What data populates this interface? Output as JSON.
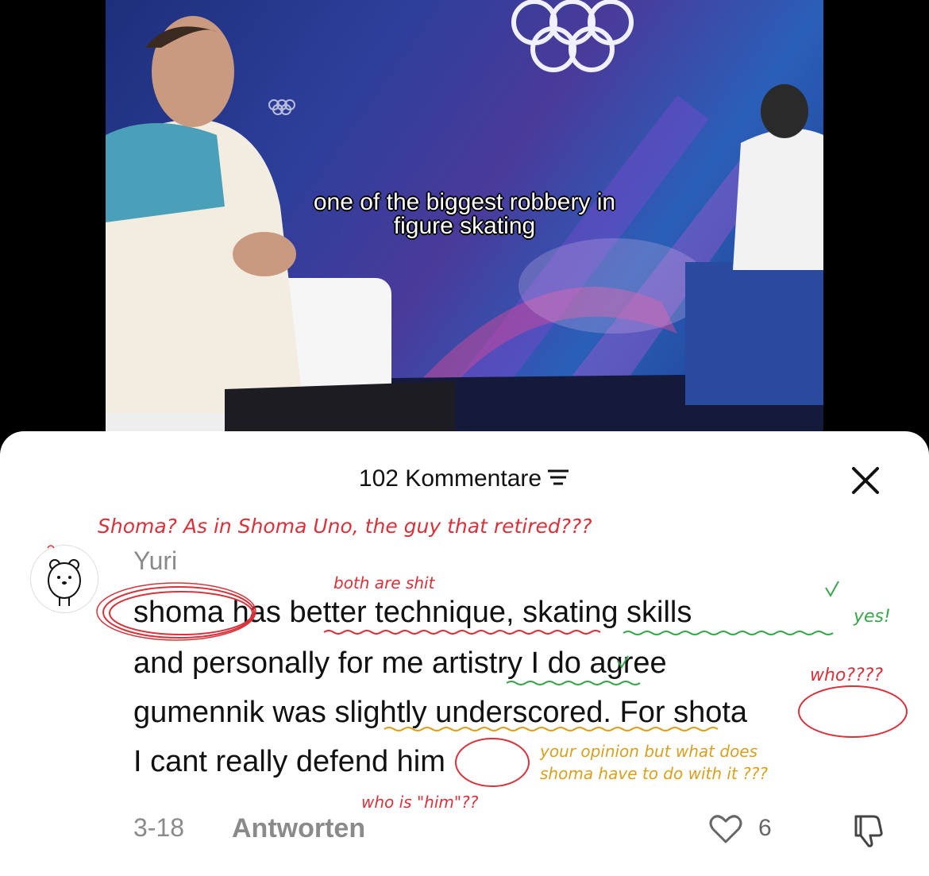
{
  "video": {
    "caption_line1": "one of the biggest robbery in",
    "caption_line2": "figure skating"
  },
  "comments_panel": {
    "count_label": "102 Kommentare",
    "sort_icon": "filter-lines-icon",
    "close_icon": "close-icon"
  },
  "comment": {
    "username": "Yuri",
    "avatar_icon": "bear-avatar-icon",
    "lines": [
      "shoma has better technique, skating skills",
      "and personally for me artistry I do agree",
      "gumennik was slightly underscored. For shota",
      "I cant really defend him"
    ],
    "date": "3-18",
    "reply_label": "Antworten",
    "likes": "6",
    "like_icon": "heart-outline-icon",
    "dislike_icon": "thumbs-down-icon"
  },
  "annotations": {
    "top_note": "Shoma? As in Shoma Uno, the guy that retired???",
    "both_are": "both are shit",
    "yes": "yes!",
    "who": "who????",
    "opinion_line1": "your opinion but what does",
    "opinion_line2": "shoma have to do with it ???",
    "who_him": "who is \"him\"??",
    "colors": {
      "red": "#d8323a",
      "green": "#3aa64a",
      "orange": "#d9a020"
    }
  }
}
